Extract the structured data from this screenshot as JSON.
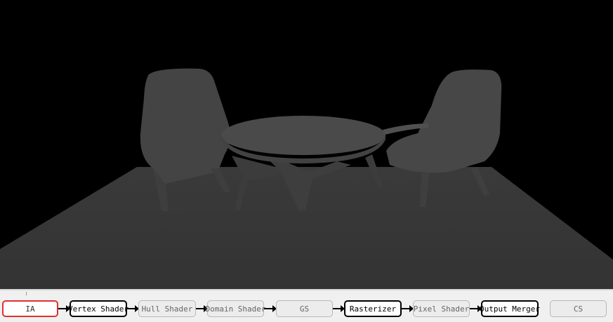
{
  "pipeline": {
    "stages": [
      {
        "label": "IA",
        "state": "selected"
      },
      {
        "label": "Vertex Shader",
        "state": "active"
      },
      {
        "label": "Hull Shader",
        "state": "inactive"
      },
      {
        "label": "Domain Shader",
        "state": "inactive"
      },
      {
        "label": "GS",
        "state": "inactive"
      },
      {
        "label": "Rasterizer",
        "state": "active"
      },
      {
        "label": "Pixel Shader",
        "state": "inactive"
      },
      {
        "label": "Output Merger",
        "state": "active"
      },
      {
        "label": "CS",
        "state": "inactive"
      }
    ]
  },
  "colors": {
    "selected_border": "#e03030",
    "active_border": "#000000",
    "inactive_border": "#b8b8b8",
    "scene_background": "#000000"
  }
}
